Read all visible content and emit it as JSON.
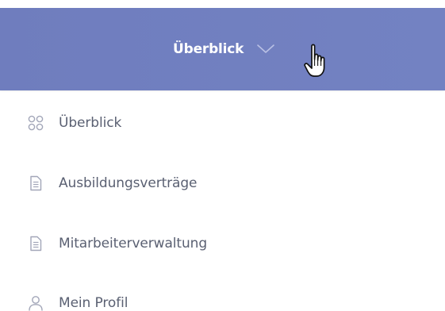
{
  "header": {
    "title": "Überblick",
    "toggle_icon": "chevron-down-icon",
    "cursor_icon": "hand-pointer-icon",
    "background_color": "#7280c1",
    "text_color": "#ffffff"
  },
  "menu": {
    "label_color": "#5a6072",
    "icon_color": "#a2a6b8",
    "items": [
      {
        "label": "Überblick",
        "icon": "grid-icon"
      },
      {
        "label": "Ausbildungsverträge",
        "icon": "document-icon"
      },
      {
        "label": "Mitarbeiterverwaltung",
        "icon": "document-icon"
      },
      {
        "label": "Mein Profil",
        "icon": "user-icon"
      }
    ]
  }
}
